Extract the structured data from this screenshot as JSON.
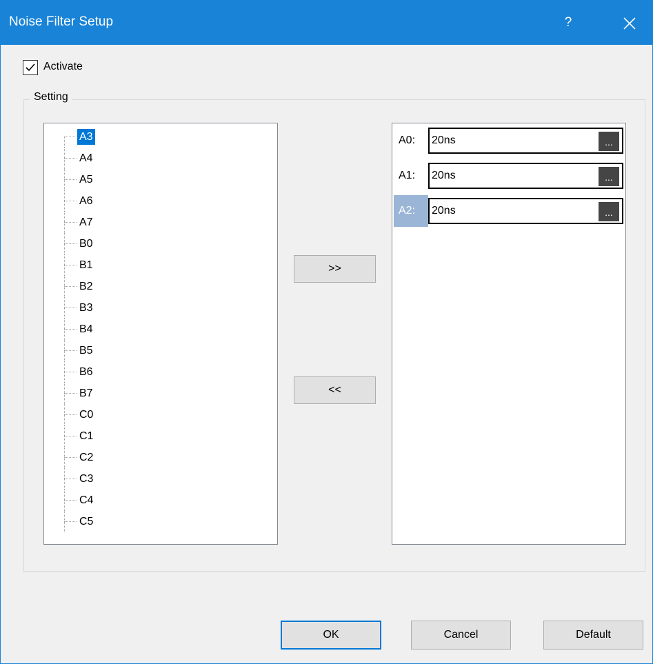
{
  "window": {
    "title": "Noise Filter Setup",
    "help_label": "?",
    "close_icon": "close-icon"
  },
  "activate": {
    "label": "Activate",
    "checked": true
  },
  "setting_group": {
    "label": "Setting"
  },
  "tree": {
    "items": [
      "A3",
      "A4",
      "A5",
      "A6",
      "A7",
      "B0",
      "B1",
      "B2",
      "B3",
      "B4",
      "B5",
      "B6",
      "B7",
      "C0",
      "C1",
      "C2",
      "C3",
      "C4",
      "C5"
    ],
    "selected": "A3"
  },
  "buttons": {
    "add": ">>",
    "remove": "<<",
    "ok": "OK",
    "cancel": "Cancel",
    "default": "Default"
  },
  "filters": [
    {
      "label": "A0:",
      "value": "20ns",
      "browse": "..."
    },
    {
      "label": "A1:",
      "value": "20ns",
      "browse": "..."
    },
    {
      "label": "A2:",
      "value": "20ns",
      "browse": "...",
      "selected": true
    }
  ],
  "colors": {
    "titlebar": "#1883d7",
    "selection": "#0078d7",
    "row_selection": "#9ab5d6"
  }
}
